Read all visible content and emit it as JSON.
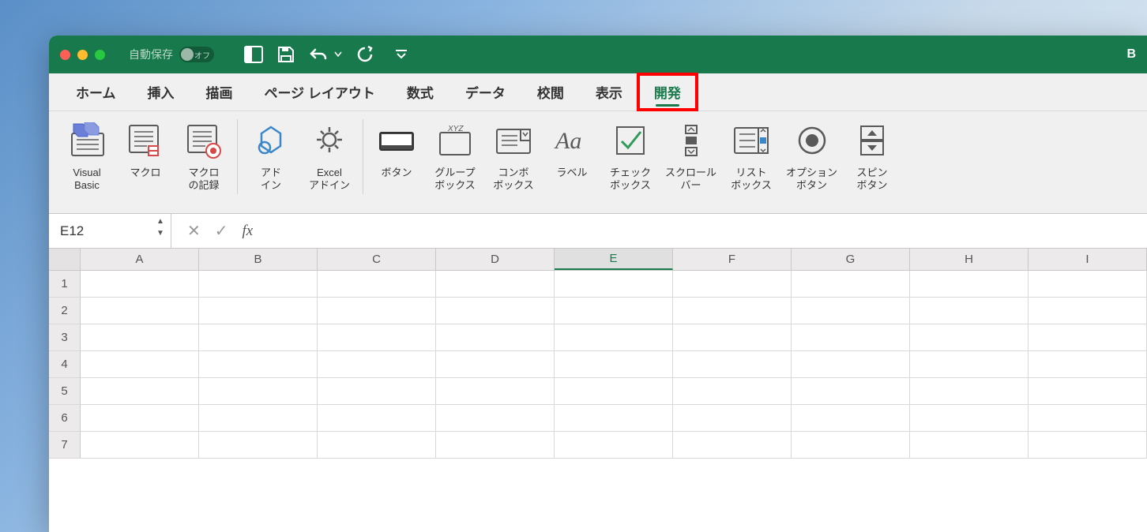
{
  "titlebar": {
    "autosave_label": "自動保存",
    "autosave_state": "オフ",
    "title_fragment": "B"
  },
  "tabs": [
    {
      "label": "ホーム",
      "active": false
    },
    {
      "label": "挿入",
      "active": false
    },
    {
      "label": "描画",
      "active": false
    },
    {
      "label": "ページ レイアウト",
      "active": false
    },
    {
      "label": "数式",
      "active": false
    },
    {
      "label": "データ",
      "active": false
    },
    {
      "label": "校閲",
      "active": false
    },
    {
      "label": "表示",
      "active": false
    },
    {
      "label": "開発",
      "active": true,
      "highlighted": true
    }
  ],
  "ribbon": {
    "visual_basic": "Visual\nBasic",
    "macro": "マクロ",
    "record_macro": "マクロ\nの記録",
    "addin": "アド\nイン",
    "excel_addin": "Excel\nアドイン",
    "button": "ボタン",
    "groupbox": "グループ\nボックス",
    "combobox": "コンボ\nボックス",
    "label": "ラベル",
    "checkbox": "チェック\nボックス",
    "scrollbar": "スクロール\nバー",
    "listbox": "リスト\nボックス",
    "optionbutton": "オプション\nボタン",
    "spinbutton": "スピン\nボタン"
  },
  "formula_bar": {
    "namebox": "E12",
    "fx": "fx",
    "value": ""
  },
  "columns": [
    "A",
    "B",
    "C",
    "D",
    "E",
    "F",
    "G",
    "H",
    "I"
  ],
  "active_column": "E",
  "rows": [
    1,
    2,
    3,
    4,
    5,
    6,
    7
  ]
}
